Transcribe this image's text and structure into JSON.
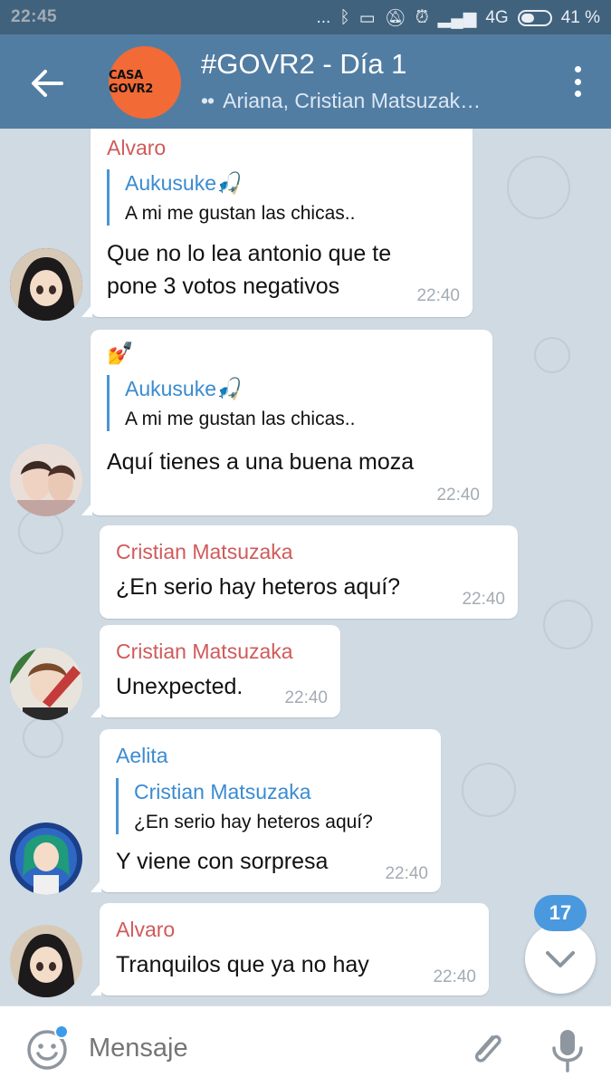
{
  "status_bar": {
    "time": "22:45",
    "network": "4G",
    "battery": "41 %",
    "signal_dots": "..."
  },
  "header": {
    "group_avatar_text": "CASA GOVR2",
    "title": "#GOVR2 - Día 1",
    "subtitle": "Ariana, Cristian Matsuzak…",
    "typing_dots": "••",
    "colors": {
      "bar": "#527da3",
      "status": "#41627d",
      "avatar": "#f26a36"
    }
  },
  "messages": [
    {
      "sender": "Alvaro",
      "sender_color": "#d05a5a",
      "reply_name": "Aukusuke🎣",
      "reply_text": "A mi me gustan las chicas..",
      "lines": [
        "Que no lo lea antonio que te",
        "pone 3 votos negativos"
      ],
      "time": "22:40"
    },
    {
      "sender": "💅",
      "reply_name": "Aukusuke🎣",
      "reply_text": "A mi me gustan las chicas..",
      "lines": [
        "Aquí tienes a una buena moza"
      ],
      "time": "22:40"
    },
    {
      "sender": "Cristian Matsuzaka",
      "sender_color": "#d05a5a",
      "lines": [
        "¿En serio hay heteros aquí?"
      ],
      "time": "22:40"
    },
    {
      "sender": "Cristian Matsuzaka",
      "sender_color": "#d05a5a",
      "lines": [
        "Unexpected."
      ],
      "time": "22:40"
    },
    {
      "sender": "Aelita",
      "sender_color": "#3a8bd1",
      "reply_name": "Cristian Matsuzaka",
      "reply_text": "¿En serio hay heteros aquí?",
      "lines": [
        "Y viene con sorpresa"
      ],
      "time": "22:40"
    },
    {
      "sender": "Alvaro",
      "sender_color": "#d05a5a",
      "lines": [
        "Tranquilos que ya no hay"
      ],
      "time": "22:40"
    }
  ],
  "unread_count": "17",
  "composer": {
    "placeholder": "Mensaje"
  }
}
